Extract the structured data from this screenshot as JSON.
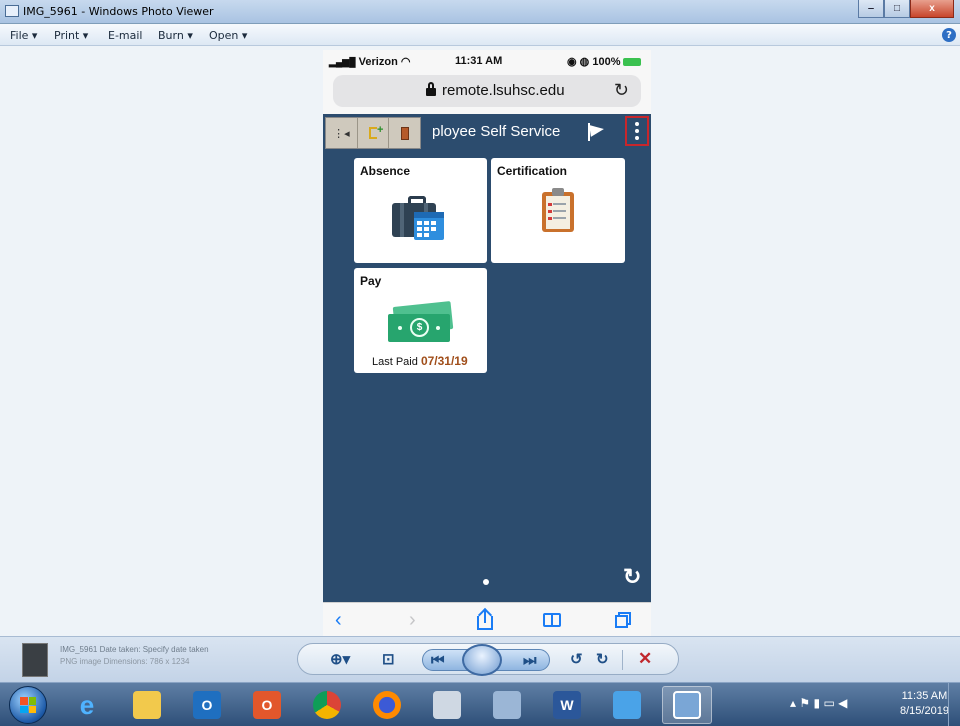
{
  "window": {
    "title": "IMG_5961 - Windows Photo Viewer",
    "minimize": "‒",
    "maximize": "□",
    "close": "x"
  },
  "menu": {
    "file": "File ▾",
    "print": "Print ▾",
    "email": "E-mail",
    "burn": "Burn ▾",
    "open": "Open ▾",
    "help": "?"
  },
  "phone": {
    "carrier": "Verizon",
    "time": "11:31 AM",
    "battery": "100%",
    "url": "remote.lsuhsc.edu",
    "app_title": "ployee Self Service",
    "tiles": {
      "absence": "Absence",
      "certification": "Certification",
      "pay": "Pay",
      "last_paid_label": "Last Paid",
      "last_paid_date": "07/31/19"
    },
    "colors": {
      "header_bg": "#2c4c6e",
      "accent_red": "#c8262b",
      "safari_blue": "#1a7cf5"
    }
  },
  "viewer": {
    "file_name_blurred": "IMG_5961 Date taken: Specify date taken",
    "file_meta_blurred": "PNG image Dimensions: 786 x 1234"
  },
  "taskbar": {
    "time": "11:35 AM",
    "date": "8/15/2019",
    "apps": [
      "internet-explorer",
      "file-explorer",
      "outlook",
      "office",
      "chrome",
      "firefox",
      "file-transfer",
      "notes",
      "word",
      "remote-desktop",
      "photo-viewer"
    ]
  }
}
